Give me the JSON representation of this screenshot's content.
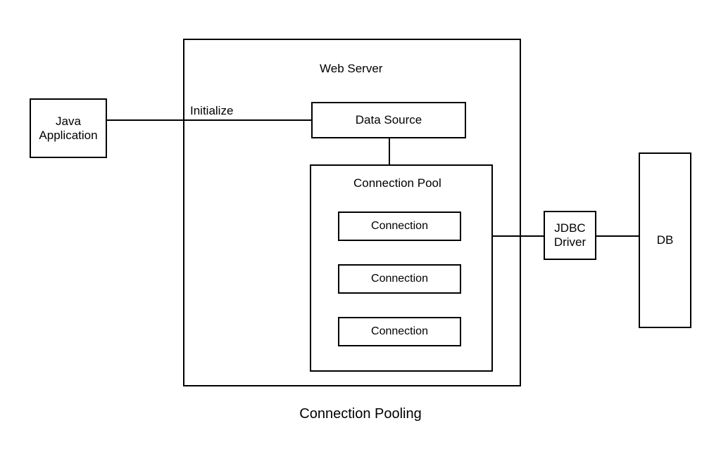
{
  "diagram": {
    "javaApp": "Java\nApplication",
    "edgeInitialize": "Initialize",
    "webServer": "Web Server",
    "dataSource": "Data Source",
    "connectionPool": "Connection Pool",
    "connections": [
      "Connection",
      "Connection",
      "Connection"
    ],
    "jdbcDriver": "JDBC\nDriver",
    "db": "DB",
    "caption": "Connection Pooling"
  }
}
